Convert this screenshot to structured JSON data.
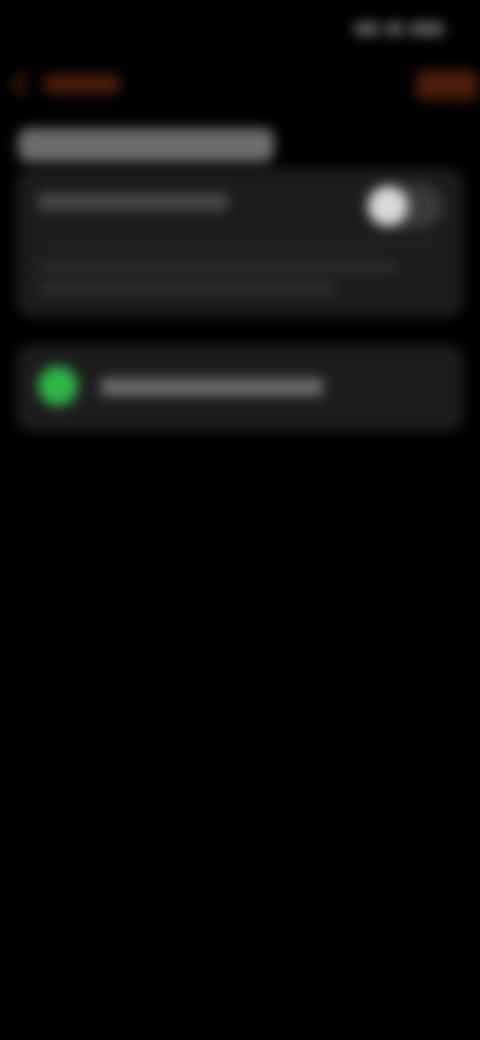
{
  "colors": {
    "background": "#000000",
    "accent": "#7a2c12",
    "card": "#1c1c1c",
    "toggle_knob": "#d9d9d9",
    "status_dot": "#2fb54a"
  },
  "status_bar": {
    "icons": [
      "signal-icon",
      "wifi-icon",
      "battery-icon"
    ]
  },
  "nav": {
    "back_icon": "chevron-left-icon"
  },
  "toggle_card": {
    "toggle_state": "off"
  },
  "status_card": {
    "indicator_color": "#2fb54a"
  }
}
